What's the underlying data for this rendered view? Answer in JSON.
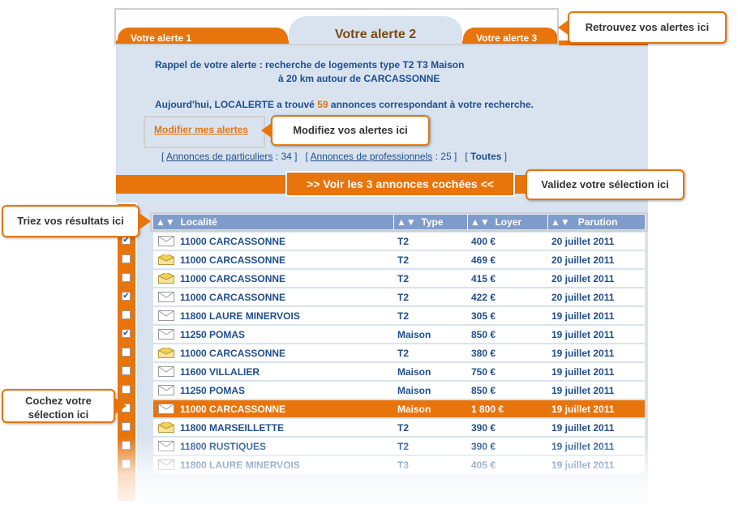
{
  "colors": {
    "accent": "#e8740c",
    "panel": "#d9e3ef",
    "header": "#7f9ccc",
    "text": "#1f4e8c"
  },
  "tabs": [
    {
      "label": "Votre alerte 1",
      "active": false
    },
    {
      "label": "Votre alerte 2",
      "active": true
    },
    {
      "label": "Votre alerte 3",
      "active": false
    }
  ],
  "summary": {
    "line1": "Rappel de votre alerte : recherche de logements type T2 T3 Maison",
    "line2": "à 20 km autour de CARCASSONNE",
    "found_prefix": "Aujourd'hui, LOCALERTE a trouvé",
    "found_count": "59",
    "found_suffix": "annonces correspondant à votre recherche."
  },
  "modify_link": "Modifier mes alertes",
  "filters": {
    "particuliers_label": "Annonces de particuliers",
    "particuliers_count": "34",
    "professionnels_label": "Annonces de professionnels",
    "professionnels_count": "25",
    "all_label": "Toutes"
  },
  "validate_button": ">> Voir les 3 annonces cochées <<",
  "table": {
    "sort_icon": "▲▼",
    "columns": [
      "Localité",
      "Type",
      "Loyer",
      "Parution"
    ],
    "rows": [
      {
        "checked": true,
        "read": true,
        "localite": "11000 CARCASSONNE",
        "type": "T2",
        "loyer": "400 €",
        "parution": "20 juillet 2011",
        "selected": false
      },
      {
        "checked": false,
        "read": false,
        "localite": "11000 CARCASSONNE",
        "type": "T2",
        "loyer": "469 €",
        "parution": "20 juillet 2011",
        "selected": false
      },
      {
        "checked": false,
        "read": false,
        "localite": "11000 CARCASSONNE",
        "type": "T2",
        "loyer": "415 €",
        "parution": "20 juillet 2011",
        "selected": false
      },
      {
        "checked": true,
        "read": true,
        "localite": "11000 CARCASSONNE",
        "type": "T2",
        "loyer": "422 €",
        "parution": "20 juillet 2011",
        "selected": false
      },
      {
        "checked": false,
        "read": true,
        "localite": "11800 LAURE MINERVOIS",
        "type": "T2",
        "loyer": "305 €",
        "parution": "19 juillet 2011",
        "selected": false
      },
      {
        "checked": true,
        "read": true,
        "localite": "11250 POMAS",
        "type": "Maison",
        "loyer": "850 €",
        "parution": "19 juillet 2011",
        "selected": false
      },
      {
        "checked": false,
        "read": false,
        "localite": "11000 CARCASSONNE",
        "type": "T2",
        "loyer": "380 €",
        "parution": "19 juillet 2011",
        "selected": false
      },
      {
        "checked": false,
        "read": true,
        "localite": "11600 VILLALIER",
        "type": "Maison",
        "loyer": "750 €",
        "parution": "19 juillet 2011",
        "selected": false
      },
      {
        "checked": false,
        "read": true,
        "localite": "11250 POMAS",
        "type": "Maison",
        "loyer": "850 €",
        "parution": "19 juillet 2011",
        "selected": false
      },
      {
        "checked": false,
        "read": true,
        "localite": "11000 CARCASSONNE",
        "type": "Maison",
        "loyer": "1 800 €",
        "parution": "19 juillet 2011",
        "selected": true
      },
      {
        "checked": false,
        "read": false,
        "localite": "11800 MARSEILLETTE",
        "type": "T2",
        "loyer": "390 €",
        "parution": "19 juillet 2011",
        "selected": false
      },
      {
        "checked": false,
        "read": true,
        "localite": "11800 RUSTIQUES",
        "type": "T2",
        "loyer": "390 €",
        "parution": "19 juillet 2011",
        "selected": false
      },
      {
        "checked": false,
        "read": true,
        "localite": "11800 LAURE MINERVOIS",
        "type": "T3",
        "loyer": "405 €",
        "parution": "19 juillet 2011",
        "selected": false
      }
    ]
  },
  "callouts": {
    "tabs": "Retrouvez vos alertes ici",
    "modify": "Modifiez vos alertes ici",
    "validate": "Validez votre sélection ici",
    "sort": "Triez vos résultats ici",
    "check_line1": "Cochez votre",
    "check_line2": "sélection ici"
  }
}
